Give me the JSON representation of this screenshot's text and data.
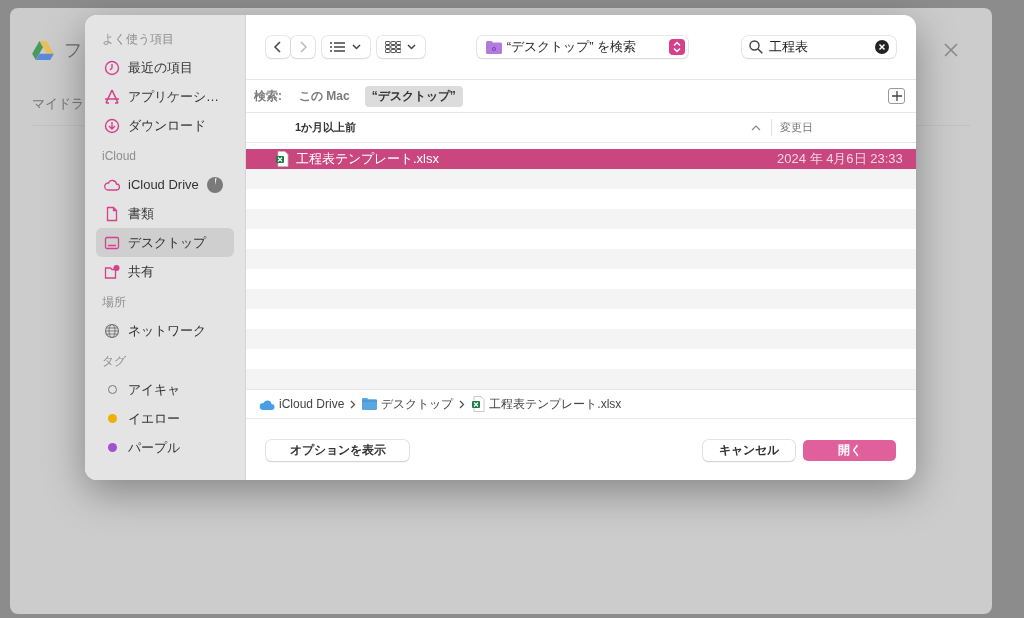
{
  "background": {
    "title": "フ",
    "tab": "マイドラ"
  },
  "sidebar": {
    "sections": [
      {
        "heading": "よく使う項目",
        "items": [
          {
            "label": "最近の項目",
            "kind": "clock",
            "selected": false
          },
          {
            "label": "アプリケーシ…",
            "kind": "apps",
            "selected": false
          },
          {
            "label": "ダウンロード",
            "kind": "download",
            "selected": false
          }
        ]
      },
      {
        "heading": "iCloud",
        "items": [
          {
            "label": "iCloud Drive",
            "kind": "cloud",
            "selected": false,
            "syncing": true
          },
          {
            "label": "書類",
            "kind": "doc",
            "selected": false
          },
          {
            "label": "デスクトップ",
            "kind": "desktop",
            "selected": true
          },
          {
            "label": "共有",
            "kind": "shared",
            "selected": false
          }
        ]
      },
      {
        "heading": "場所",
        "items": [
          {
            "label": "ネットワーク",
            "kind": "globe",
            "selected": false
          }
        ]
      },
      {
        "heading": "タグ",
        "items": [
          {
            "label": "アイキャ",
            "kind": "tag-empty",
            "selected": false
          },
          {
            "label": "イエロー",
            "kind": "tag",
            "color": "#f0b000",
            "selected": false
          },
          {
            "label": "パープル",
            "kind": "tag",
            "color": "#a44fd0",
            "selected": false
          }
        ]
      }
    ]
  },
  "toolbar": {
    "navigation": [
      {
        "kind": "back",
        "disabled": false
      },
      {
        "kind": "forward",
        "disabled": true
      }
    ],
    "location": "“デスクトップ” を検索",
    "search": {
      "value": "工程表"
    }
  },
  "scope": {
    "label": "検索:",
    "options": [
      {
        "label": "この Mac",
        "selected": false
      },
      {
        "label": "“デスクトップ”",
        "selected": true
      }
    ]
  },
  "table": {
    "columns": [
      {
        "label": "1か月以上前",
        "sorted": true
      },
      {
        "label": "変更日",
        "sorted": false
      }
    ],
    "rows": [
      {
        "name": "工程表テンプレート.xlsx",
        "modified": "2024 年 4月6日 23:33",
        "selected": true
      }
    ]
  },
  "path": [
    {
      "label": "iCloud Drive",
      "kind": "cloud"
    },
    {
      "label": "デスクトップ",
      "kind": "folder"
    },
    {
      "label": "工程表テンプレート.xlsx",
      "kind": "excel"
    }
  ],
  "buttons": [
    {
      "label": "オプションを表示",
      "kind": "secondary"
    },
    {
      "label": "キャンセル",
      "kind": "secondary"
    },
    {
      "label": "開く",
      "kind": "primary"
    }
  ]
}
